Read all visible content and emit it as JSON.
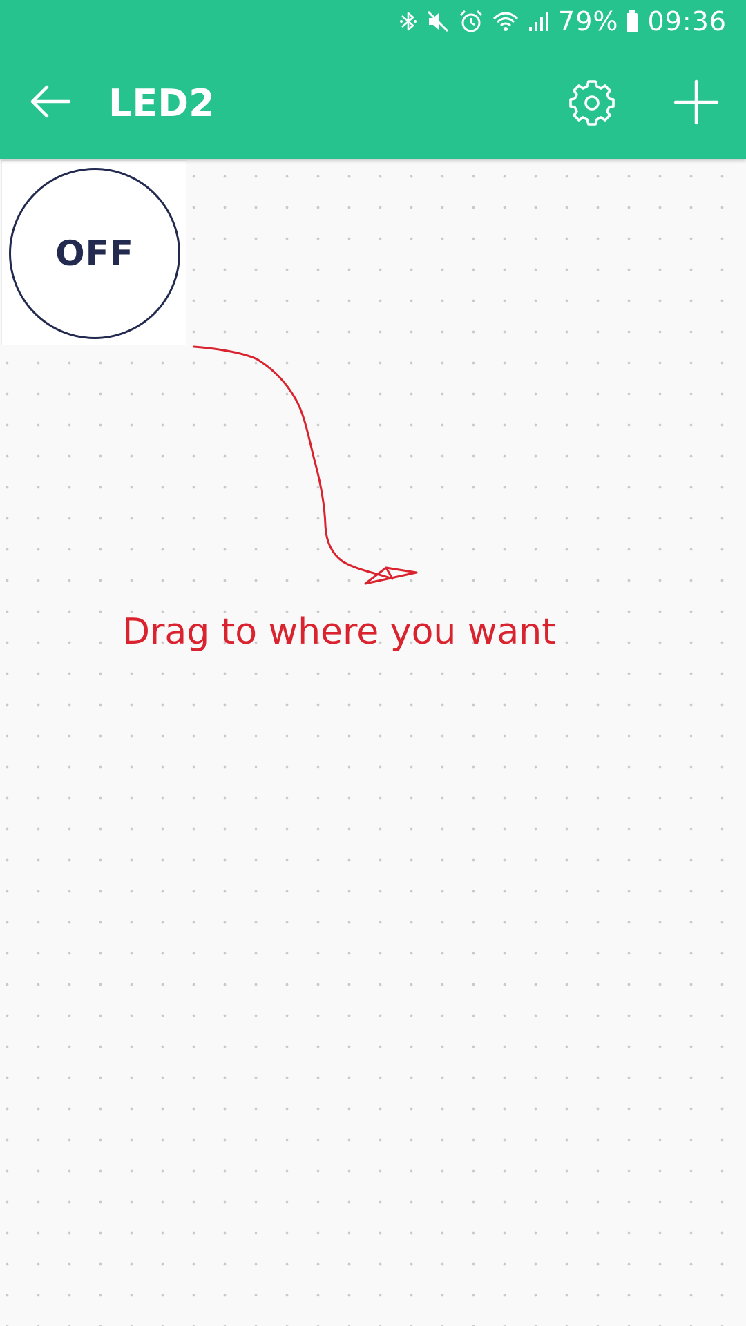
{
  "status_bar": {
    "battery_percent": "79%",
    "time": "09:36",
    "icons": [
      "bluetooth-icon",
      "mute-icon",
      "alarm-icon",
      "wifi-icon",
      "signal-icon",
      "battery-icon"
    ]
  },
  "app_bar": {
    "title": "LED2",
    "back_icon": "arrow-left-icon",
    "settings_icon": "gear-icon",
    "add_icon": "plus-icon",
    "background_color": "#26c38e"
  },
  "canvas": {
    "widget": {
      "type": "button",
      "label": "OFF",
      "color": "#232a4f"
    },
    "annotation": {
      "text": "Drag to where you want",
      "color": "#d9232e"
    }
  }
}
